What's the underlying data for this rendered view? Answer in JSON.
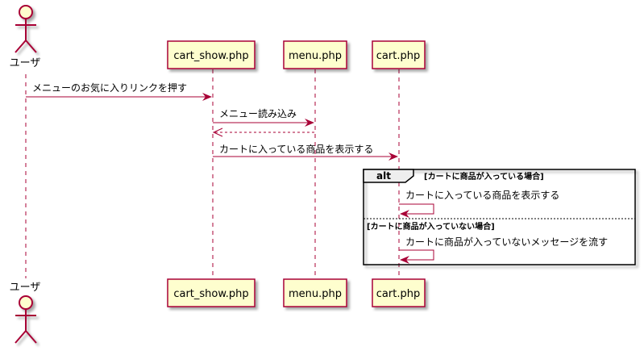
{
  "participants": {
    "user": "ユーザ",
    "cart_show": "cart_show.php",
    "menu": "menu.php",
    "cart": "cart.php"
  },
  "messages": {
    "m1": "メニューのお気に入りリンクを押す",
    "m2": "メニュー読み込み",
    "m4": "カートに入っている商品を表示する",
    "m5": "カートに入っている商品を表示する",
    "m6": "カートに商品が入っていないメッセージを流す"
  },
  "alt": {
    "keyword": "alt",
    "guard1": "[カートに商品が入っている場合]",
    "guard2": "[カートに商品が入っていない場合]"
  },
  "colors": {
    "line": "#A80036",
    "box_fill": "#FEFECE",
    "frame_fill": "#EEEEEE"
  }
}
